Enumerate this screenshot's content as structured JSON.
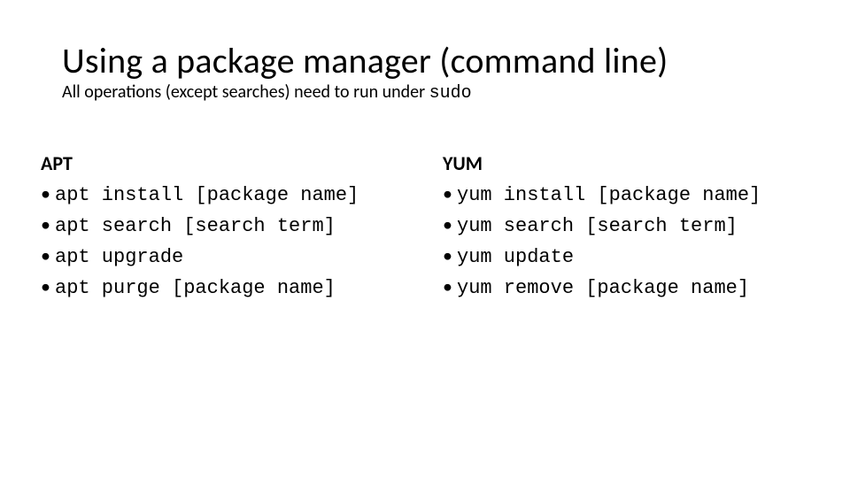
{
  "title": "Using a package manager (command line)",
  "subtitle_prefix": "All operations (except searches) need to run under ",
  "subtitle_code": "sudo",
  "columns": {
    "left": {
      "heading": "APT",
      "items": [
        "apt install [package name]",
        "apt search [search term]",
        "apt upgrade",
        "apt purge [package name]"
      ]
    },
    "right": {
      "heading": "YUM",
      "items": [
        "yum install [package name]",
        "yum search [search term]",
        "yum update",
        "yum remove [package name]"
      ]
    }
  }
}
